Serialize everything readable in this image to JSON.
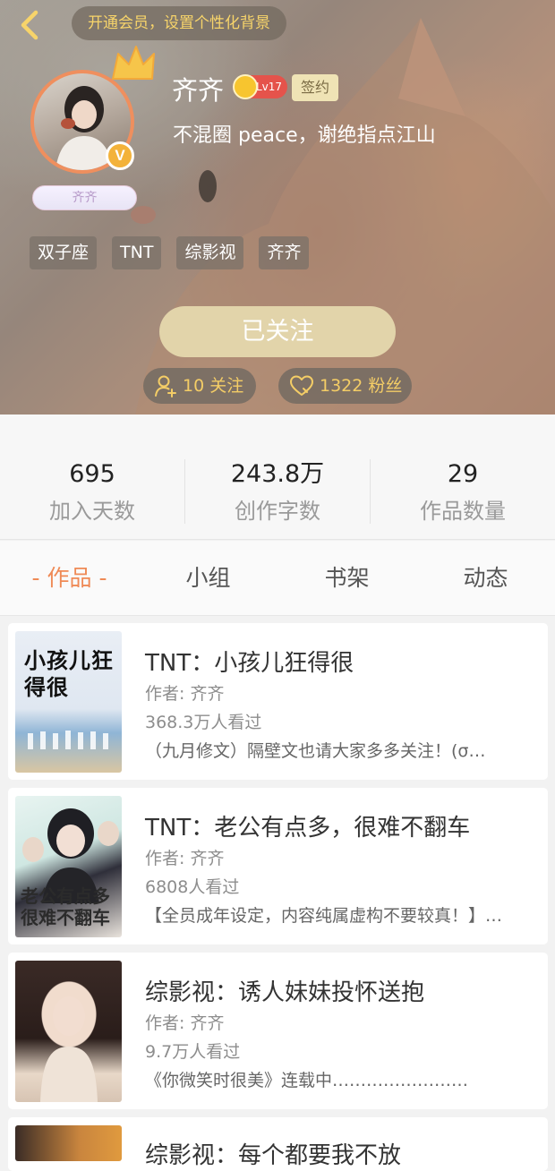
{
  "header": {
    "vip_prompt": "开通会员，设置个性化背景",
    "avatar_name": "齐齐",
    "username": "齐齐",
    "level": "Lv17",
    "signed": "签约",
    "bio": "不混圈 peace，谢绝指点江山",
    "tags": [
      "双子座",
      "TNT",
      "综影视",
      "齐齐"
    ],
    "follow_button": "已关注",
    "following_count": "10 关注",
    "fans_count": "1322 粉丝"
  },
  "stats": [
    {
      "value": "695",
      "label": "加入天数"
    },
    {
      "value": "243.8万",
      "label": "创作字数"
    },
    {
      "value": "29",
      "label": "作品数量"
    }
  ],
  "tabs": [
    "- 作品 -",
    "小组",
    "书架",
    "动态"
  ],
  "works": [
    {
      "title": "TNT：小孩儿狂得很",
      "author": "作者: 齐齐",
      "views": "368.3万人看过",
      "intro": "（九月修文）隔壁文也请大家多多关注！(σ…",
      "cover_text": "小孩儿狂得很"
    },
    {
      "title": "TNT：老公有点多，很难不翻车",
      "author": "作者: 齐齐",
      "views": "6808人看过",
      "intro": "【全员成年设定，内容纯属虚构不要较真！】…",
      "cover_text": "老公有点多很难不翻车"
    },
    {
      "title": "综影视：诱人妹妹投怀送抱",
      "author": "作者: 齐齐",
      "views": "9.7万人看过",
      "intro": "《你微笑时很美》连载中……………………"
    }
  ],
  "partial_title": "综影视：每个都要我不放",
  "colors": {
    "accent": "#ef8a56",
    "gold": "#f4cd66",
    "follow_btn": "#e2d4aa"
  }
}
